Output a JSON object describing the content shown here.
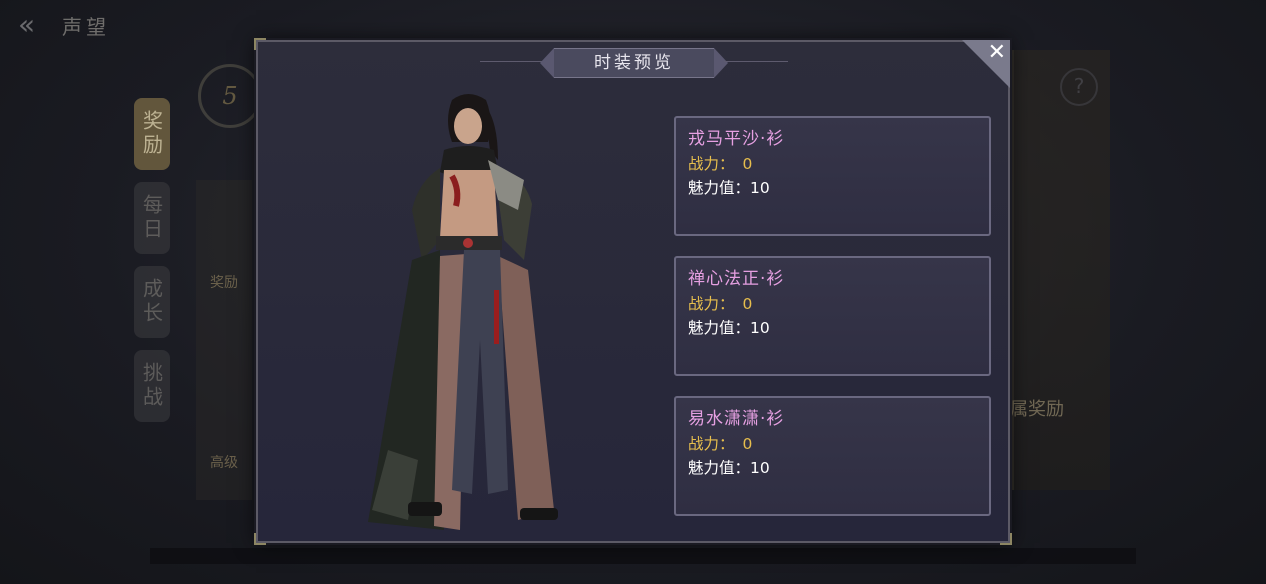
{
  "background": {
    "header_title": "声望",
    "side_tabs": [
      "奖励",
      "每日",
      "成长",
      "挑战"
    ],
    "level": "5",
    "col_labels": [
      "奖励",
      "高级"
    ],
    "right_text": "属奖励",
    "help_symbol": "?"
  },
  "modal": {
    "title": "时装预览",
    "close_symbol": "✕",
    "power_label": "战力：",
    "charm_label": "魅力值：",
    "items": [
      {
        "name": "戎马平沙·衫",
        "power": "0",
        "charm": "10"
      },
      {
        "name": "禅心法正·衫",
        "power": "0",
        "charm": "10"
      },
      {
        "name": "易水潇潇·衫",
        "power": "0",
        "charm": "10"
      }
    ]
  },
  "colors": {
    "modal_bg": "#2d2d3b",
    "item_name": "#e6a0e2",
    "power": "#e7be4d",
    "charm": "#ffffff"
  }
}
